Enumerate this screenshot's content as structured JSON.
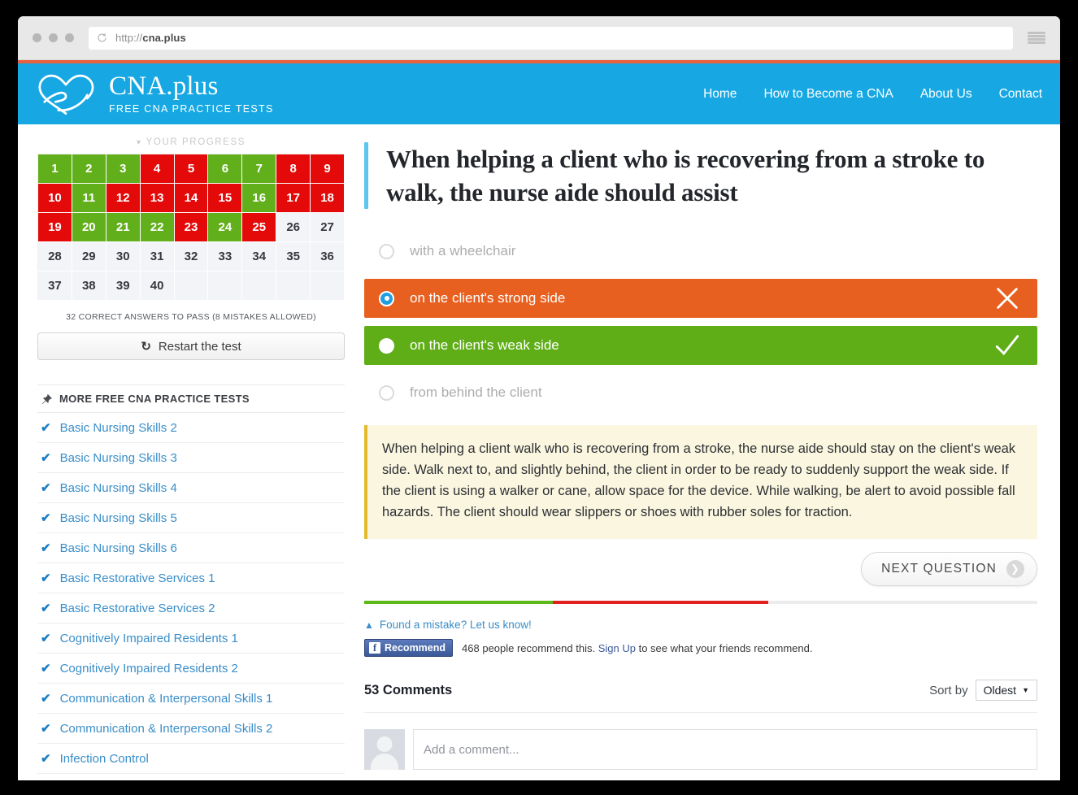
{
  "browser": {
    "url_prefix": "http://",
    "url_domain": "cna.plus",
    "reload_icon": "reload-icon",
    "menu_icon": "hamburger-menu-icon"
  },
  "header": {
    "logo_icon": "heart-hand-logo",
    "brand_title": "CNA.plus",
    "brand_subtitle": "FREE CNA PRACTICE TESTS",
    "nav": [
      {
        "label": "Home"
      },
      {
        "label": "How to Become a CNA"
      },
      {
        "label": "About Us"
      },
      {
        "label": "Contact"
      }
    ]
  },
  "sidebar": {
    "progress_title": "YOUR PROGRESS",
    "progress_chevron": "chevron-down-icon",
    "grid": [
      {
        "n": "1",
        "state": "correct"
      },
      {
        "n": "2",
        "state": "correct"
      },
      {
        "n": "3",
        "state": "correct"
      },
      {
        "n": "4",
        "state": "wrong"
      },
      {
        "n": "5",
        "state": "wrong"
      },
      {
        "n": "6",
        "state": "correct"
      },
      {
        "n": "7",
        "state": "correct"
      },
      {
        "n": "8",
        "state": "wrong"
      },
      {
        "n": "9",
        "state": "wrong"
      },
      {
        "n": "10",
        "state": "wrong"
      },
      {
        "n": "11",
        "state": "correct"
      },
      {
        "n": "12",
        "state": "wrong"
      },
      {
        "n": "13",
        "state": "wrong"
      },
      {
        "n": "14",
        "state": "wrong"
      },
      {
        "n": "15",
        "state": "wrong"
      },
      {
        "n": "16",
        "state": "correct"
      },
      {
        "n": "17",
        "state": "wrong"
      },
      {
        "n": "18",
        "state": "wrong"
      },
      {
        "n": "19",
        "state": "wrong"
      },
      {
        "n": "20",
        "state": "correct"
      },
      {
        "n": "21",
        "state": "correct"
      },
      {
        "n": "22",
        "state": "correct"
      },
      {
        "n": "23",
        "state": "wrong"
      },
      {
        "n": "24",
        "state": "correct"
      },
      {
        "n": "25",
        "state": "wrong"
      },
      {
        "n": "26",
        "state": "blank"
      },
      {
        "n": "27",
        "state": "blank"
      },
      {
        "n": "28",
        "state": "blank"
      },
      {
        "n": "29",
        "state": "blank"
      },
      {
        "n": "30",
        "state": "blank"
      },
      {
        "n": "31",
        "state": "blank"
      },
      {
        "n": "32",
        "state": "blank"
      },
      {
        "n": "33",
        "state": "blank"
      },
      {
        "n": "34",
        "state": "blank"
      },
      {
        "n": "35",
        "state": "blank"
      },
      {
        "n": "36",
        "state": "blank"
      },
      {
        "n": "37",
        "state": "blank"
      },
      {
        "n": "38",
        "state": "blank"
      },
      {
        "n": "39",
        "state": "blank"
      },
      {
        "n": "40",
        "state": "blank"
      },
      {
        "n": "",
        "state": "empty"
      },
      {
        "n": "",
        "state": "empty"
      },
      {
        "n": "",
        "state": "empty"
      },
      {
        "n": "",
        "state": "empty"
      },
      {
        "n": "",
        "state": "empty"
      }
    ],
    "pass_note": "32 CORRECT ANSWERS TO PASS (8 MISTAKES ALLOWED)",
    "restart_label": "Restart the test",
    "restart_icon": "refresh-icon",
    "more_tests_title": "MORE FREE CNA PRACTICE TESTS",
    "more_tests_icon": "pushpin-icon",
    "more_tests": [
      {
        "label": "Basic Nursing Skills 2"
      },
      {
        "label": "Basic Nursing Skills 3"
      },
      {
        "label": "Basic Nursing Skills 4"
      },
      {
        "label": "Basic Nursing Skills 5"
      },
      {
        "label": "Basic Nursing Skills 6"
      },
      {
        "label": "Basic Restorative Services 1"
      },
      {
        "label": "Basic Restorative Services 2"
      },
      {
        "label": "Cognitively Impaired Residents 1"
      },
      {
        "label": "Cognitively Impaired Residents 2"
      },
      {
        "label": "Communication & Interpersonal Skills 1"
      },
      {
        "label": "Communication & Interpersonal Skills 2"
      },
      {
        "label": "Infection Control"
      }
    ],
    "check_icon": "check-icon"
  },
  "question": {
    "text": "When helping a client who is recovering from a stroke to walk, the nurse aide should assist",
    "options": [
      {
        "label": "with a wheelchair",
        "state": "neutral",
        "mark": ""
      },
      {
        "label": "on the client's strong side",
        "state": "wrong",
        "mark": "cross-icon"
      },
      {
        "label": "on the client's weak side",
        "state": "right",
        "mark": "check-icon"
      },
      {
        "label": "from behind the client",
        "state": "neutral",
        "mark": ""
      }
    ],
    "explanation": "When helping a client walk who is recovering from a stroke, the nurse aide should stay on the client's weak side. Walk next to, and slightly behind, the client in order to be ready to suddenly support the weak side. If the client is using a walker or cane, allow space for the device. While walking, be alert to avoid possible fall hazards. The client should wear slippers or shoes with rubber soles for traction.",
    "next_label": "NEXT QUESTION",
    "next_arrow_icon": "chevron-right-icon"
  },
  "progress_bar": {
    "green_pct": "28%",
    "red_pct": "32%"
  },
  "feedback": {
    "mistake_icon": "warning-triangle-icon",
    "mistake_label": "Found a mistake? Let us know!",
    "fb_icon": "facebook-icon",
    "fb_button_label": "Recommend",
    "fb_count_text": "468 people recommend this.",
    "fb_signup_link": "Sign Up",
    "fb_tail_text": "to see what your friends recommend."
  },
  "comments": {
    "count_label": "53 Comments",
    "sort_by_label": "Sort by",
    "sort_value": "Oldest",
    "sort_caret_icon": "caret-down-icon",
    "avatar_icon": "default-avatar-icon",
    "input_placeholder": "Add a comment..."
  },
  "colors": {
    "brand_blue": "#17a8e3",
    "accent_orange": "#e8603c",
    "correct_green": "#62af1c",
    "wrong_red": "#e40a0a",
    "option_orange": "#e8601f",
    "option_green": "#5fae18",
    "explain_bg": "#fbf6df",
    "explain_border": "#e5bb2c",
    "link_blue": "#3a8ec9"
  }
}
